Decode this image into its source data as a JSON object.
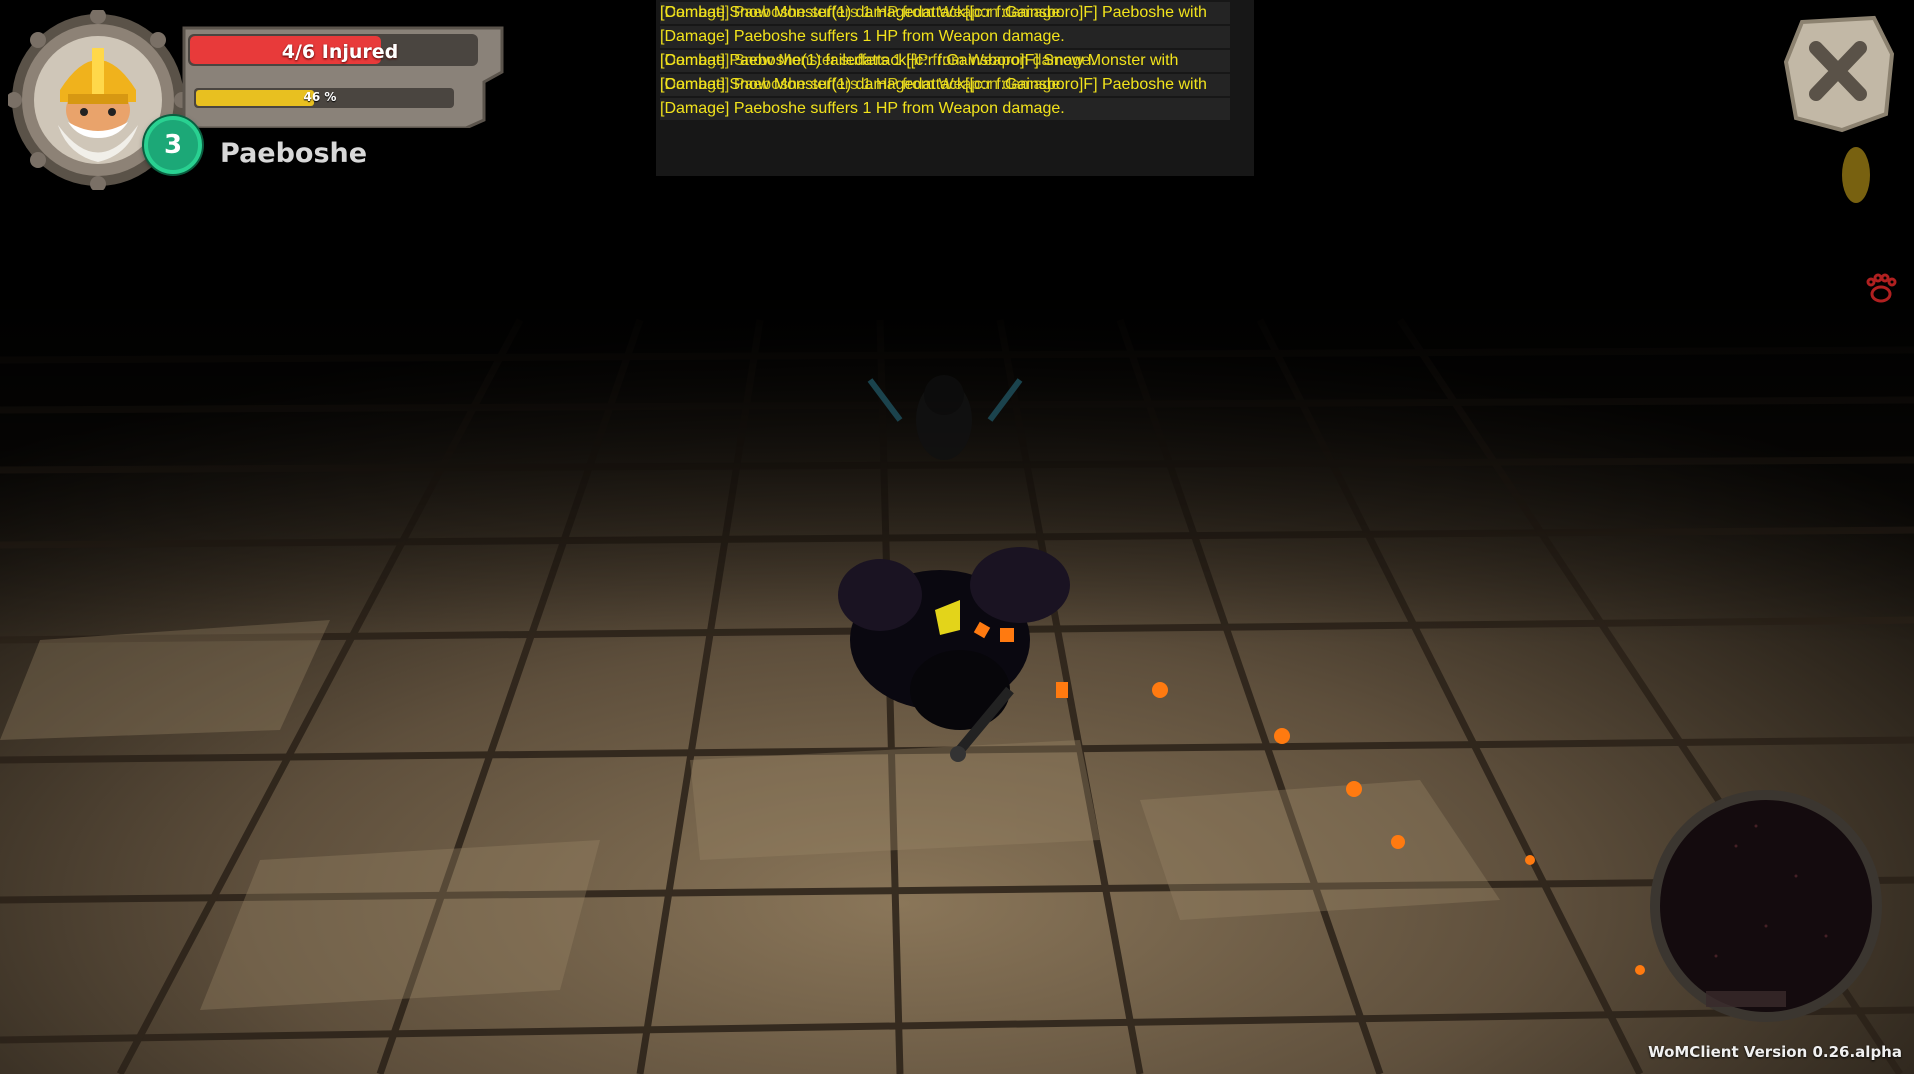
{
  "player": {
    "health_label": "4/6 Injured",
    "health_fraction": 0.667,
    "xp_label": "46 %",
    "xp_fraction": 0.46,
    "level": "3",
    "name": "Paeboshe"
  },
  "chat": {
    "lines": [
      {
        "text": "[Combat] Snow Monster(1) damagedattack[[c:r f:Gainsboro]F] Paeboshe with",
        "overlay": "[Damage] Paeboshe suffers 1 HP from Weapon damage."
      },
      {
        "text": "[Damage] Paeboshe suffers 1 HP from Weapon damage.",
        "overlay": ""
      },
      {
        "text": "[Combat] Paeboshe(1) failedattack[[c:r f:Gainsboro]F] Snow Monster with",
        "overlay": "[Damage] Snow Monster suffers 1 HP from Weapon damage."
      },
      {
        "text": "[Combat] Snow Monster(1) damagedattack[[c:r f:Gainsboro]F] Paeboshe with",
        "overlay": "[Damage] Paeboshe suffers 1 HP from Weapon damage."
      },
      {
        "text": "[Damage] Paeboshe suffers 1 HP from Weapon damage.",
        "overlay": ""
      }
    ]
  },
  "version": "WoMClient Version 0.26.alpha",
  "icons": {
    "close": "close-x-icon",
    "portrait": "dwarf-helmet-portrait-icon",
    "side": "paw-print-icon"
  },
  "colors": {
    "health": "#e83a3a",
    "xp": "#e8c020",
    "level_badge": "#1ca877",
    "chat_text": "#f2e31c",
    "floor": "#6b5a44"
  }
}
